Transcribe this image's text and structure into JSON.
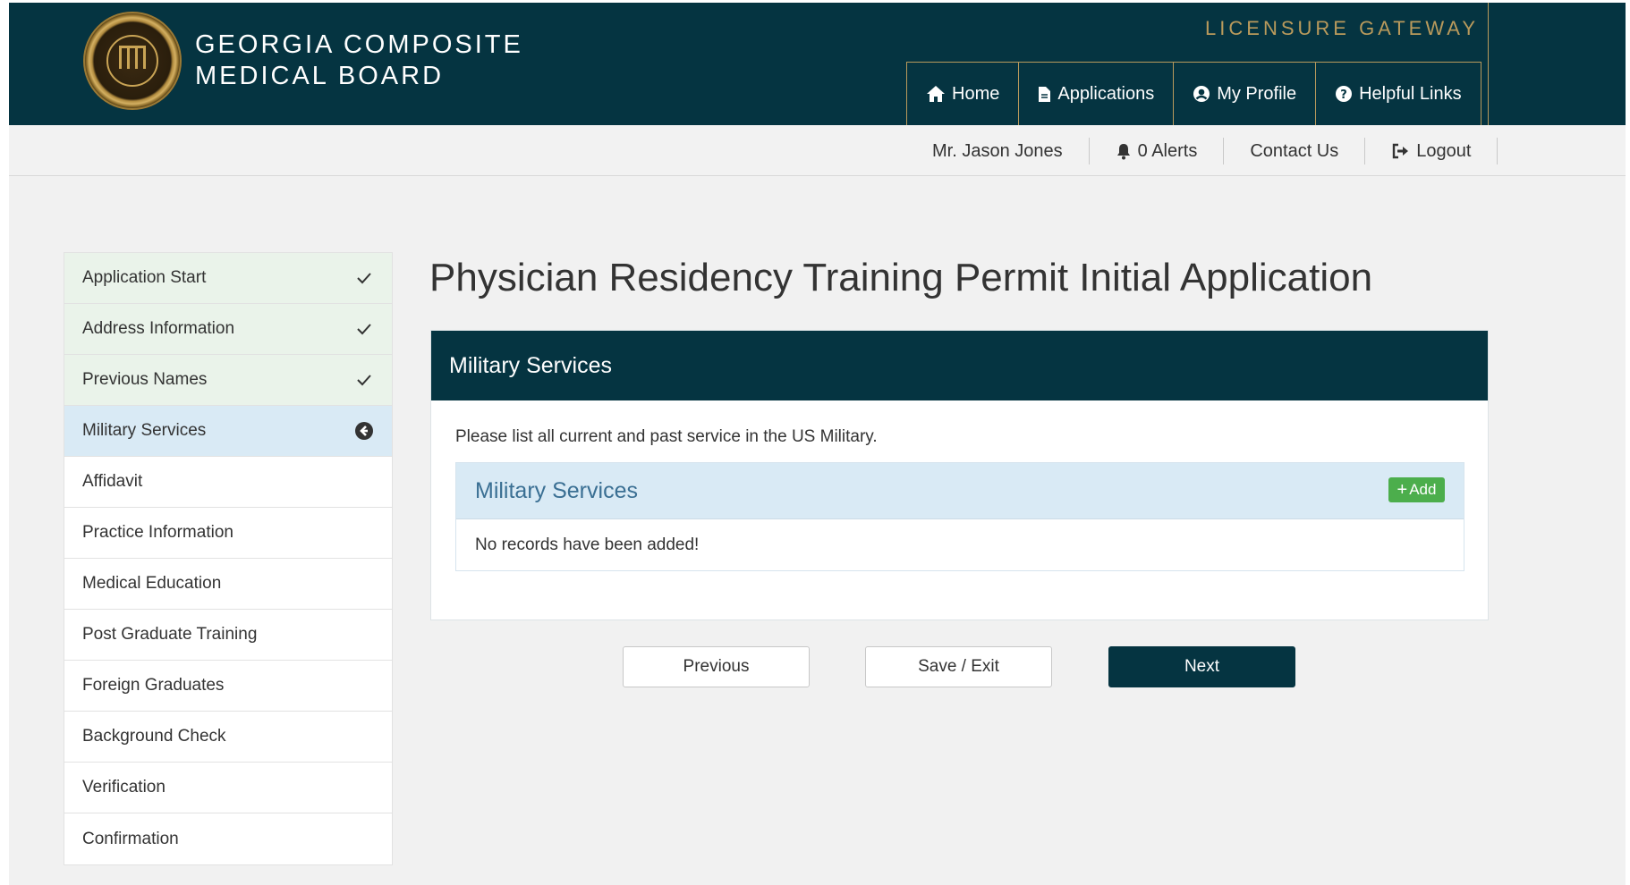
{
  "header": {
    "org_line1": "GEORGIA COMPOSITE",
    "org_line2": "MEDICAL BOARD",
    "gateway": "LICENSURE GATEWAY",
    "nav": [
      {
        "label": "Home",
        "icon": "home-icon"
      },
      {
        "label": "Applications",
        "icon": "document-icon"
      },
      {
        "label": "My Profile",
        "icon": "user-circle-icon"
      },
      {
        "label": "Helpful Links",
        "icon": "question-circle-icon"
      }
    ]
  },
  "subheader": {
    "user": "Mr. Jason Jones",
    "alerts": "0 Alerts",
    "contact": "Contact Us",
    "logout": "Logout"
  },
  "sidebar": {
    "items": [
      {
        "label": "Application Start",
        "state": "done"
      },
      {
        "label": "Address Information",
        "state": "done"
      },
      {
        "label": "Previous Names",
        "state": "done"
      },
      {
        "label": "Military Services",
        "state": "active"
      },
      {
        "label": "Affidavit",
        "state": ""
      },
      {
        "label": "Practice Information",
        "state": ""
      },
      {
        "label": "Medical Education",
        "state": ""
      },
      {
        "label": "Post Graduate Training",
        "state": ""
      },
      {
        "label": "Foreign Graduates",
        "state": ""
      },
      {
        "label": "Background Check",
        "state": ""
      },
      {
        "label": "Verification",
        "state": ""
      },
      {
        "label": "Confirmation",
        "state": ""
      }
    ]
  },
  "main": {
    "title": "Physician Residency Training Permit Initial Application",
    "panel_title": "Military Services",
    "description": "Please list all current and past service in the US Military.",
    "subpanel_title": "Military Services",
    "add_label": "Add",
    "empty_message": "No records have been added!"
  },
  "buttons": {
    "previous": "Previous",
    "save_exit": "Save / Exit",
    "next": "Next"
  },
  "colors": {
    "header_bg": "#053441",
    "gold": "#b99a5c",
    "done_bg": "#eaf3ea",
    "active_bg": "#d9eaf5",
    "add_green": "#4cae4c"
  }
}
